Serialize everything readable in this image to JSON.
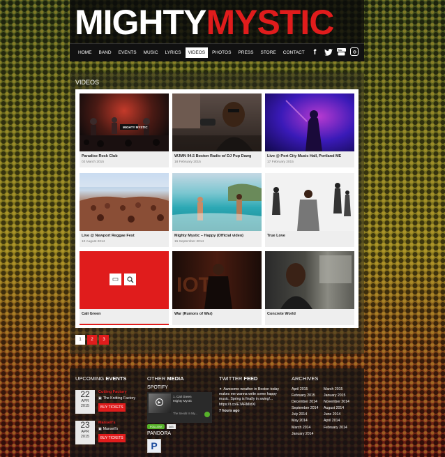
{
  "logo": {
    "part1": "MIGHTY",
    "part2": "MYSTIC"
  },
  "nav": [
    "HOME",
    "BAND",
    "EVENTS",
    "MUSIC",
    "LYRICS",
    "VIDEOS",
    "PHOTOS",
    "PRESS",
    "STORE",
    "CONTACT"
  ],
  "nav_active": "VIDEOS",
  "social_icons": [
    "facebook-icon",
    "twitter-icon",
    "youtube-icon",
    "instagram-icon"
  ],
  "videos": {
    "title": "VIDEOS",
    "items": [
      {
        "title": "Paradise Rock Club",
        "date": "02 March 2015"
      },
      {
        "title": "WJMN 94.5 Boston Radio w/ DJ Pup Dawg",
        "date": "18 February 2015"
      },
      {
        "title": "Live @ Port City Music Hall, Portland ME",
        "date": "17 February 2015"
      },
      {
        "title": "Live @ Newport Reggae Fest",
        "date": "10 August 2014"
      },
      {
        "title": "Mighty Mystic – Happy (Official video)",
        "date": "15 September 2014"
      },
      {
        "title": "True Love",
        "date": ""
      },
      {
        "title": "Cali Green",
        "date": ""
      },
      {
        "title": "War (Rumors of War)",
        "date": ""
      },
      {
        "title": "Concrete World",
        "date": ""
      }
    ]
  },
  "pagination": [
    "1",
    "2",
    "3"
  ],
  "footer": {
    "events_title_a": "UPCOMING ",
    "events_title_b": "EVENTS",
    "events": [
      {
        "day": "22",
        "month": "APR",
        "year": "2015",
        "name": "Cutting Factory",
        "venue": "The Knitting Factory",
        "button": "BUY TICKETS"
      },
      {
        "day": "23",
        "month": "APR",
        "year": "2015",
        "name": "Mansell's",
        "venue": "Mansell's",
        "button": "BUY TICKETS"
      }
    ],
    "media_title_a": "OTHER ",
    "media_title_b": "MEDIA",
    "spotify_label": "SPOTIFY",
    "spotify_track": "1. Cali Green",
    "spotify_artist": "Mighty Mystic",
    "spotify_next": "The Seeds In My...",
    "follow_label": "FOLLOW",
    "follow_count": "383",
    "pandora_label": "PANDORA",
    "twitter_title_a": "TWITTER ",
    "twitter_title_b": "FEED",
    "tweet_text": "Awesome weather in Boston today makes me wanna write some happy music. Spring is finally in swing!... https://t.co/E7ARMIdXl",
    "tweet_ago": "7 hours ago",
    "archives_title": "ARCHIVES",
    "archives": [
      "April 2015",
      "March 2015",
      "February 2015",
      "January 2015",
      "December 2014",
      "November 2014",
      "September 2014",
      "August 2014",
      "July 2014",
      "June 2014",
      "May 2014",
      "April 2014",
      "March 2014",
      "February 2014",
      "January 2014"
    ]
  },
  "colors": {
    "accent": "#e01c1c",
    "dark": "#111111"
  }
}
